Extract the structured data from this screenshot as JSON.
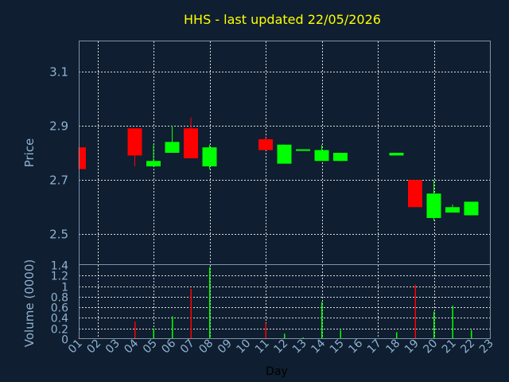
{
  "chart_data": [
    {
      "type": "candlestick",
      "title": "HHS - last updated 22/05/2026",
      "ylabel": "Price",
      "xlabel": "Day",
      "ylim": [
        2.39,
        3.21
      ],
      "yticks": [
        "2.5",
        "2.7",
        "2.9",
        "3.1"
      ],
      "grid": true,
      "colors": {
        "up": "#00ff00",
        "down": "#ff0000",
        "title": "#ffff00",
        "text": "#8fb2d0",
        "background": "#0f1e30"
      },
      "candles": [
        {
          "day": "01",
          "open": 2.82,
          "high": 2.82,
          "low": 2.74,
          "close": 2.74
        },
        {
          "day": "04",
          "open": 2.89,
          "high": 2.89,
          "low": 2.75,
          "close": 2.79
        },
        {
          "day": "05",
          "open": 2.75,
          "high": 2.83,
          "low": 2.75,
          "close": 2.77
        },
        {
          "day": "06",
          "open": 2.8,
          "high": 2.9,
          "low": 2.8,
          "close": 2.84
        },
        {
          "day": "07",
          "open": 2.89,
          "high": 2.93,
          "low": 2.78,
          "close": 2.78
        },
        {
          "day": "08",
          "open": 2.75,
          "high": 2.83,
          "low": 2.74,
          "close": 2.82
        },
        {
          "day": "11",
          "open": 2.85,
          "high": 2.86,
          "low": 2.81,
          "close": 2.81
        },
        {
          "day": "12",
          "open": 2.76,
          "high": 2.83,
          "low": 2.76,
          "close": 2.83
        },
        {
          "day": "13",
          "open": 2.81,
          "high": 2.81,
          "low": 2.81,
          "close": 2.81
        },
        {
          "day": "14",
          "open": 2.77,
          "high": 2.83,
          "low": 2.77,
          "close": 2.81
        },
        {
          "day": "15",
          "open": 2.77,
          "high": 2.8,
          "low": 2.77,
          "close": 2.8
        },
        {
          "day": "18",
          "open": 2.79,
          "high": 2.8,
          "low": 2.79,
          "close": 2.8
        },
        {
          "day": "19",
          "open": 2.7,
          "high": 2.7,
          "low": 2.6,
          "close": 2.6
        },
        {
          "day": "20",
          "open": 2.56,
          "high": 2.7,
          "low": 2.55,
          "close": 2.65
        },
        {
          "day": "21",
          "open": 2.58,
          "high": 2.61,
          "low": 2.58,
          "close": 2.6
        },
        {
          "day": "22",
          "open": 2.57,
          "high": 2.62,
          "low": 2.57,
          "close": 2.62
        }
      ]
    },
    {
      "type": "bar",
      "ylabel": "Volume (0000)",
      "xlabel": "Day",
      "ylim": [
        0,
        1.4
      ],
      "yticks": [
        "0",
        "0.2",
        "0.4",
        "0.6",
        "0.8",
        "1",
        "1.2",
        "1.4"
      ],
      "categories": [
        "01",
        "02",
        "03",
        "04",
        "05",
        "06",
        "07",
        "08",
        "09",
        "10",
        "11",
        "12",
        "13",
        "14",
        "15",
        "16",
        "17",
        "18",
        "19",
        "20",
        "21",
        "22",
        "23"
      ],
      "bars": [
        {
          "day": "01",
          "value": 0.03,
          "color": "#ff0000"
        },
        {
          "day": "04",
          "value": 0.33,
          "color": "#ff0000"
        },
        {
          "day": "05",
          "value": 0.2,
          "color": "#00ff00"
        },
        {
          "day": "06",
          "value": 0.43,
          "color": "#00ff00"
        },
        {
          "day": "07",
          "value": 0.95,
          "color": "#ff0000"
        },
        {
          "day": "08",
          "value": 1.36,
          "color": "#00ff00"
        },
        {
          "day": "11",
          "value": 0.3,
          "color": "#ff0000"
        },
        {
          "day": "12",
          "value": 0.1,
          "color": "#00ff00"
        },
        {
          "day": "13",
          "value": 0.03,
          "color": "#00ff00"
        },
        {
          "day": "14",
          "value": 0.7,
          "color": "#00ff00"
        },
        {
          "day": "15",
          "value": 0.17,
          "color": "#00ff00"
        },
        {
          "day": "18",
          "value": 0.13,
          "color": "#00ff00"
        },
        {
          "day": "19",
          "value": 1.03,
          "color": "#ff0000"
        },
        {
          "day": "20",
          "value": 0.52,
          "color": "#00ff00"
        },
        {
          "day": "21",
          "value": 0.63,
          "color": "#00ff00"
        },
        {
          "day": "22",
          "value": 0.17,
          "color": "#00ff00"
        }
      ]
    }
  ]
}
